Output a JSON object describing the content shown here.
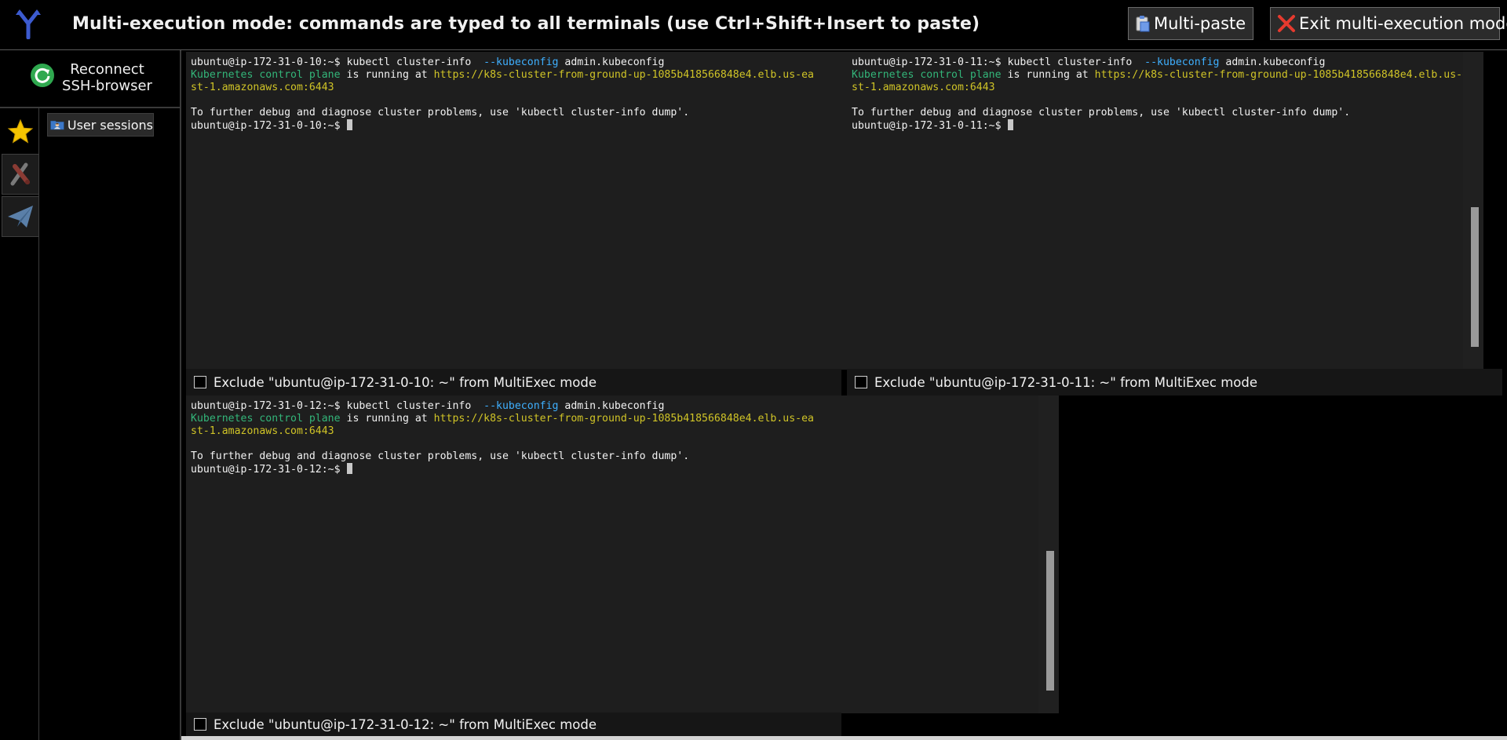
{
  "topbar": {
    "title": "Multi-execution mode: commands are typed to all terminals (use Ctrl+Shift+Insert to paste)",
    "multipaste_label": "Multi-paste",
    "exit_label": "Exit multi-execution mode"
  },
  "sidebar": {
    "reconnect_line1": "Reconnect",
    "reconnect_line2": "SSH-browser",
    "user_sessions_label": "User sessions",
    "icons": [
      "star-icon",
      "tools-icon",
      "send-icon"
    ]
  },
  "terminals": [
    {
      "host": "ubuntu@ip-172-31-0-10",
      "prompt": "ubuntu@ip-172-31-0-10:~$ ",
      "cmd_a": "kubectl cluster-info  ",
      "cmd_flag": "--kubeconfig",
      "cmd_b": " admin.kubeconfig",
      "green_text": "Kubernetes control plane",
      "running_text": " is running at ",
      "url_line1": "https://k8s-cluster-from-ground-up-1085b418566848e4.elb.us-ea",
      "url_line2": "st-1.amazonaws.com:6443",
      "debug_text": "To further debug and diagnose cluster problems, use 'kubectl cluster-info dump'.",
      "exclude_label": "Exclude \"ubuntu@ip-172-31-0-10: ~\" from MultiExec mode"
    },
    {
      "host": "ubuntu@ip-172-31-0-11",
      "prompt": "ubuntu@ip-172-31-0-11:~$ ",
      "cmd_a": "kubectl cluster-info  ",
      "cmd_flag": "--kubeconfig",
      "cmd_b": " admin.kubeconfig",
      "green_text": "Kubernetes control plane",
      "running_text": " is running at ",
      "url_line1": "https://k8s-cluster-from-ground-up-1085b418566848e4.elb.us-ea",
      "url_line2": "st-1.amazonaws.com:6443",
      "debug_text": "To further debug and diagnose cluster problems, use 'kubectl cluster-info dump'.",
      "exclude_label": "Exclude \"ubuntu@ip-172-31-0-11: ~\" from MultiExec mode"
    },
    {
      "host": "ubuntu@ip-172-31-0-12",
      "prompt": "ubuntu@ip-172-31-0-12:~$ ",
      "cmd_a": "kubectl cluster-info  ",
      "cmd_flag": "--kubeconfig",
      "cmd_b": " admin.kubeconfig",
      "green_text": "Kubernetes control plane",
      "running_text": " is running at ",
      "url_line1": "https://k8s-cluster-from-ground-up-1085b418566848e4.elb.us-ea",
      "url_line2": "st-1.amazonaws.com:6443",
      "debug_text": "To further debug and diagnose cluster problems, use 'kubectl cluster-info dump'.",
      "exclude_label": "Exclude \"ubuntu@ip-172-31-0-12: ~\" from MultiExec mode"
    }
  ],
  "colors": {
    "green": "#33b579",
    "blue": "#3fb0ff",
    "yellow": "#d0c427",
    "star": "#f5c400",
    "reconnect": "#2fa84f"
  }
}
